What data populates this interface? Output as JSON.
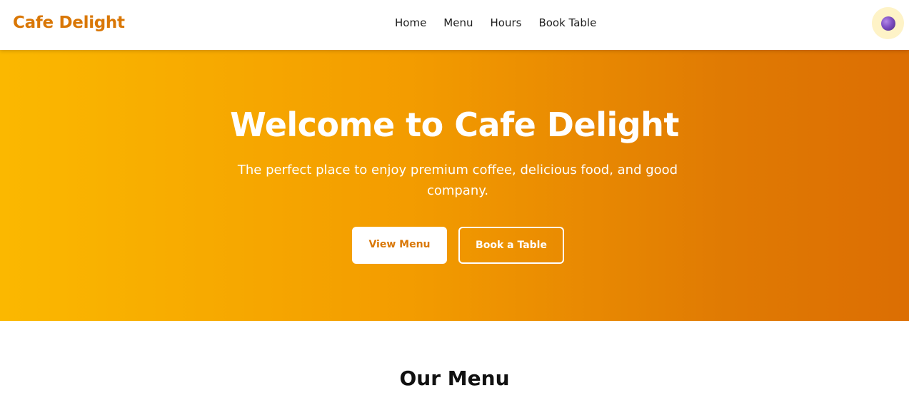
{
  "navbar": {
    "brand": "Cafe Delight",
    "links": [
      {
        "label": "Home"
      },
      {
        "label": "Menu"
      },
      {
        "label": "Hours"
      },
      {
        "label": "Book Table"
      }
    ],
    "theme_toggle_icon": "moon-orb-icon"
  },
  "hero": {
    "title": "Welcome to Cafe Delight",
    "subtitle": "The perfect place to enjoy premium coffee, delicious food, and good company.",
    "primary_button": "View Menu",
    "secondary_button": "Book a Table"
  },
  "menu_section": {
    "title": "Our Menu"
  },
  "colors": {
    "accent": "#d97706",
    "hero_start": "#fbb800",
    "hero_end": "#dc6e03",
    "toggle_bg": "#fef3c7"
  }
}
